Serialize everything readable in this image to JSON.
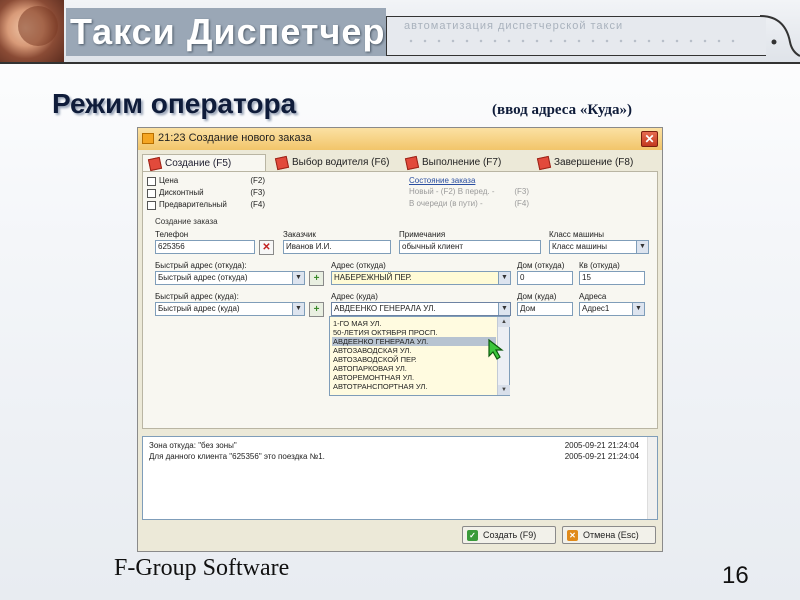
{
  "banner": {
    "title": "Такси Диспетчер",
    "subtitle": "автоматизация диспетчерской такси"
  },
  "slide": {
    "title": "Режим оператора",
    "note": "(ввод адреса «Куда»)",
    "footer": "F-Group Software",
    "page_number": "16"
  },
  "window": {
    "title": "21:23 Создание нового заказа",
    "close_icon": "close-icon",
    "tabs": [
      {
        "label": "Создание (F5)",
        "active": true
      },
      {
        "label": "Выбор водителя (F6)",
        "active": false
      },
      {
        "label": "Выполнение (F7)",
        "active": false
      },
      {
        "label": "Завершение (F8)",
        "active": false
      }
    ],
    "options": [
      {
        "label": "Цена",
        "key": "(F2)"
      },
      {
        "label": "Дисконтный",
        "key": "(F3)"
      },
      {
        "label": "Предварительный",
        "key": "(F4)"
      }
    ],
    "status": {
      "link": "Состояние заказа",
      "lines": [
        {
          "label": "Новый - (F2)   В перед. -",
          "key": "(F3)"
        },
        {
          "label": "В очереди (в пути) -",
          "key": "(F4)"
        }
      ]
    },
    "section_label": "Создание заказа",
    "form": {
      "phone_label": "Телефон",
      "phone_value": "625356",
      "customer_label": "Заказчик",
      "customer_value": "Иванов И.И.",
      "notes_label": "Примечания",
      "notes_value": "обычный клиент",
      "car_class_label": "Класс машины",
      "car_class_value": "Класс машины",
      "quick_from_label": "Быстрый адрес (откуда):",
      "quick_from_value": "Быстрый адрес (откуда)",
      "addr_from_label": "Адрес (откуда)",
      "addr_from_value": "НАБЕРЕЖНЫЙ ПЕР.",
      "house_from_label": "Дом (откуда)",
      "house_from_value": "0",
      "apt_from_label": "Кв (откуда)",
      "apt_from_value": "15",
      "quick_to_label": "Быстрый адрес (куда):",
      "quick_to_value": "Быстрый адрес (куда)",
      "addr_to_label": "Адрес (куда)",
      "addr_to_value": "АВДЕЕНКО ГЕНЕРАЛА УЛ.",
      "house_to_label": "Дом (куда)",
      "house_to_value": "Дом",
      "address_label": "Адреса",
      "address_value": "Адрес1"
    },
    "street_list": [
      {
        "label": "1-ГО МАЯ УЛ.",
        "selected": false
      },
      {
        "label": "50-ЛЕТИЯ ОКТЯБРЯ ПРОСП.",
        "selected": false
      },
      {
        "label": "АВДЕЕНКО ГЕНЕРАЛА УЛ.",
        "selected": true
      },
      {
        "label": "АВТОЗАВОДСКАЯ УЛ.",
        "selected": false
      },
      {
        "label": "АВТОЗАВОДСКОЙ ПЕР.",
        "selected": false
      },
      {
        "label": "АВТОПАРКОВАЯ УЛ.",
        "selected": false
      },
      {
        "label": "АВТОРЕМОНТНАЯ УЛ.",
        "selected": false
      },
      {
        "label": "АВТОТРАНСПОРТНАЯ УЛ.",
        "selected": false
      }
    ],
    "log": [
      {
        "text": "Зона откуда: \"без зоны\"",
        "time": "2005-09-21 21:24:04"
      },
      {
        "text": "Для данного клиента \"625356\" это поездка №1.",
        "time": "2005-09-21 21:24:04"
      }
    ],
    "buttons": {
      "create": "Создать (F9)",
      "cancel": "Отмена (Esc)"
    }
  },
  "colors": {
    "accent_title": "#0f1c3a",
    "window_bg": "#ece9d8",
    "selection": "#b7c3d1"
  }
}
